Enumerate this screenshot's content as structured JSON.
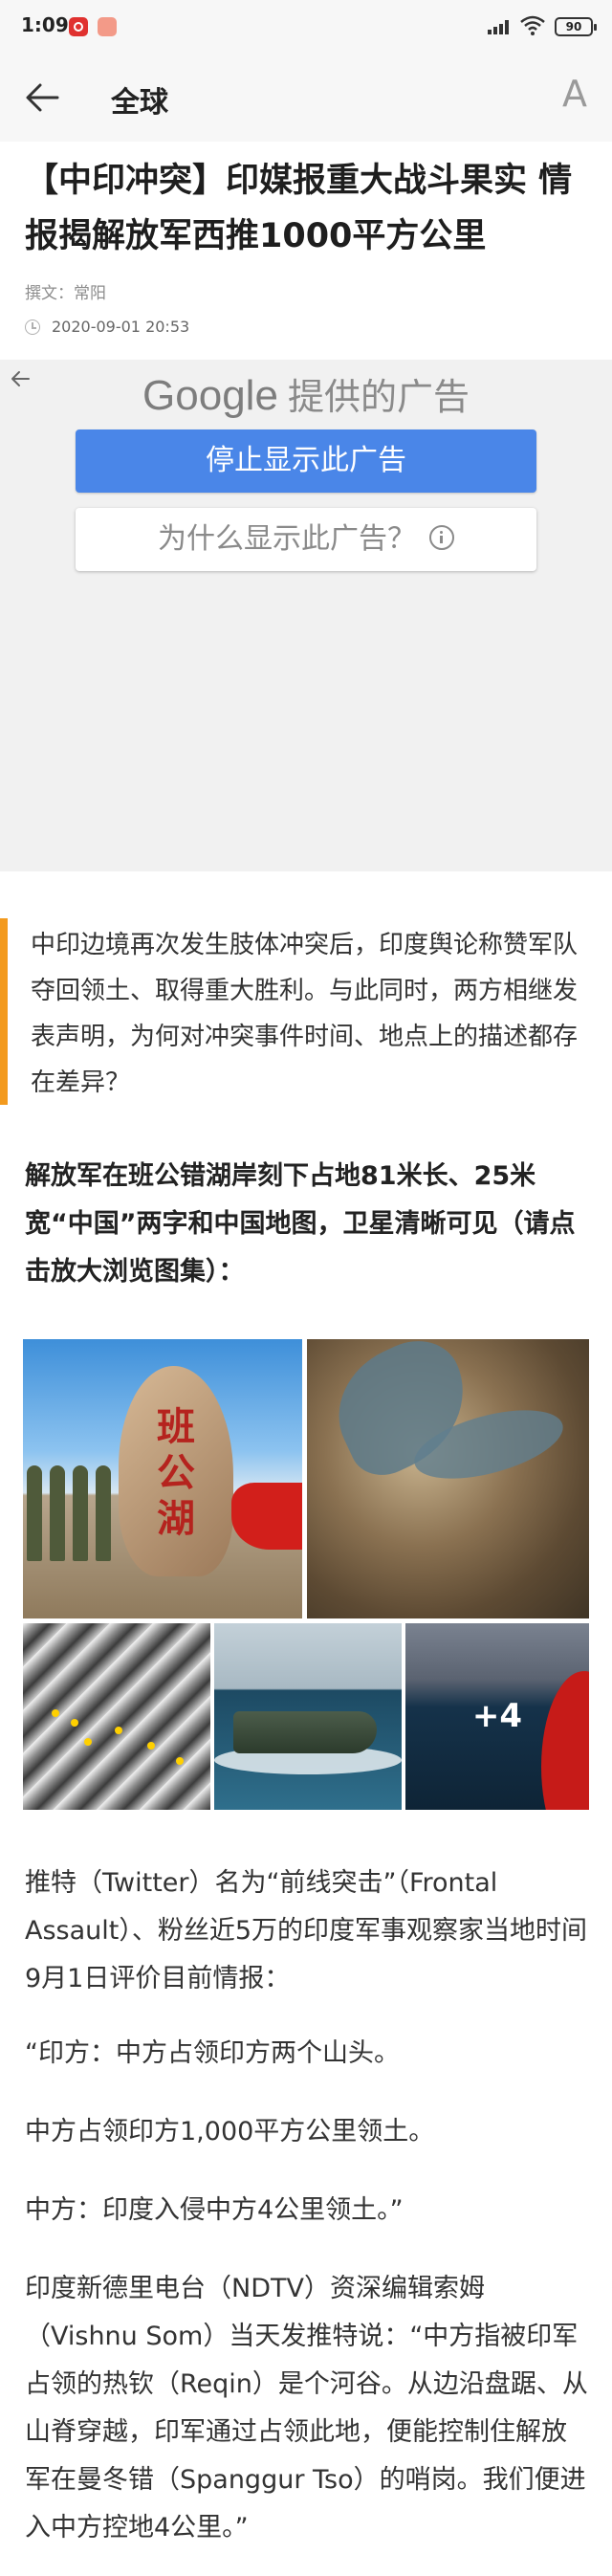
{
  "status_bar": {
    "time": "1:09",
    "battery": "90"
  },
  "header": {
    "title": "全球",
    "font_button_label": "A"
  },
  "article": {
    "title": "【中印冲突】印媒报重大战斗果实 情报揭解放军西推1000平方公里",
    "author": "撰文：常阳",
    "date": "2020-09-01 20:53"
  },
  "ad": {
    "google_label": "Google",
    "provided_label": "提供的广告",
    "stop_button_label": "停止显示此广告",
    "why_button_label": "为什么显示此广告？"
  },
  "lead_quote": "中印边境再次发生肢体冲突后，印度舆论称赞军队夺回领土、取得重大胜利。与此同时，两方相继发表声明，为何对冲突事件时间、地点上的描述都存在差异？",
  "bold_paragraph": "解放军在班公错湖岸刻下占地81米长、25米宽“中国”两字和中国地图，卫星清晰可见（请点击放大浏览图集）：",
  "gallery": {
    "rock_text": "班公湖",
    "more_label": "+4"
  },
  "paragraphs": [
    "推特（Twitter）名为“前线突击”（Frontal Assault）、粉丝近5万的印度军事观察家当地时间9月1日评价目前情报：",
    "“印方：中方占领印方两个山头。",
    "中方占领印方1,000平方公里领土。",
    "中方：印度入侵中方4公里领土。”",
    "印度新德里电台（NDTV）资深编辑索姆（Vishnu Som）当天发推特说：“中方指被印军占领的热钦（Reqin）是个河谷。从边沿盘踞、从山脊穿越，印军通过占领此地，便能控制住解放军在曼冬错（Spanggur Tso）的哨岗。我们便进入中方控地4公里。”"
  ]
}
